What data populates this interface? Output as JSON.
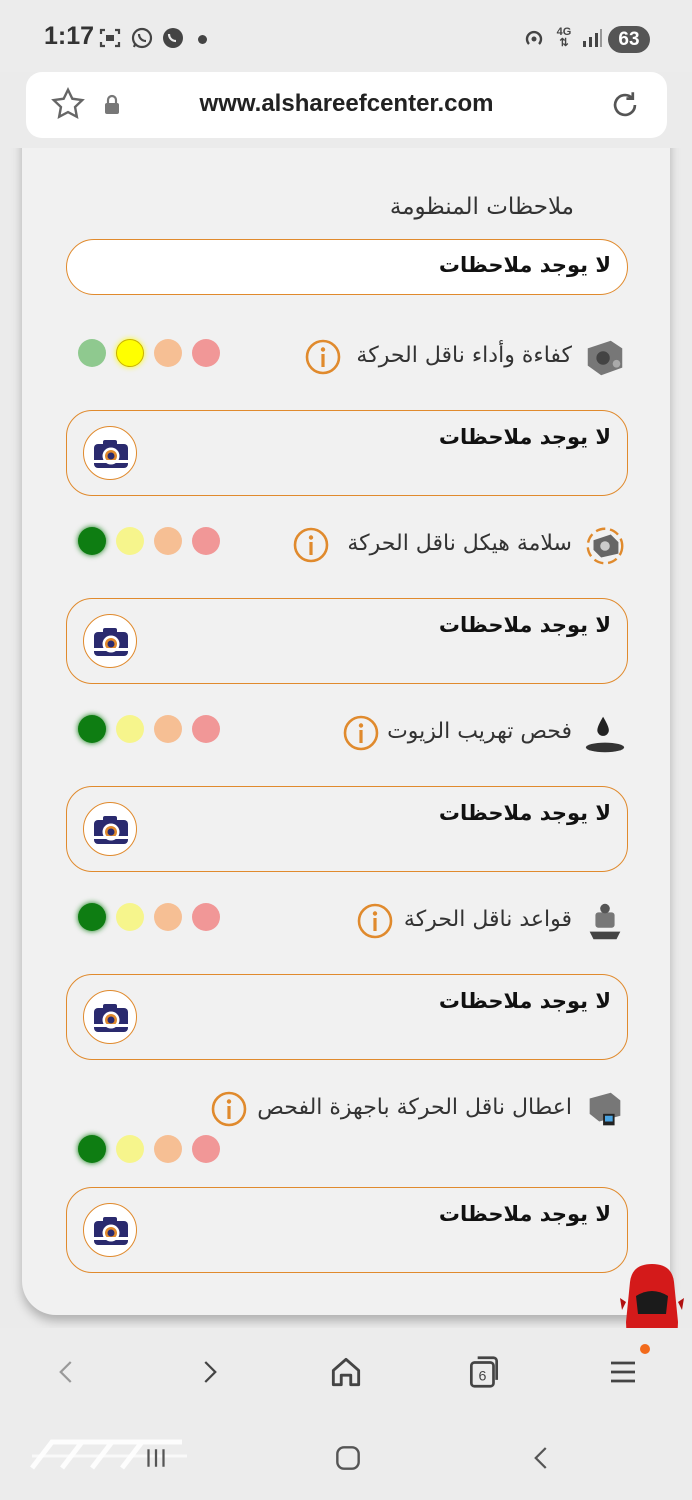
{
  "status_bar": {
    "time": "1:17",
    "battery": "63",
    "network": "4G"
  },
  "browser": {
    "url": "www.alshareefcenter.com",
    "tab_count": "6"
  },
  "system_notes": {
    "title": "ملاحظات المنظومة",
    "value": "لا يوجد ملاحظات"
  },
  "items": [
    {
      "label": "كفاءة وأداء ناقل الحركة",
      "note": "لا يوجد ملاحظات",
      "selected_light": "yellow"
    },
    {
      "label": "سلامة هيكل ناقل الحركة",
      "note": "لا يوجد ملاحظات",
      "selected_light": "green"
    },
    {
      "label": "فحص تهريب الزيوت",
      "note": "لا يوجد ملاحظات",
      "selected_light": "green"
    },
    {
      "label": "قواعد ناقل الحركة",
      "note": "لا يوجد ملاحظات",
      "selected_light": "green"
    },
    {
      "label": "اعطال ناقل الحركة باجهزة الفحص",
      "note": "لا يوجد ملاحظات",
      "selected_light": "green"
    }
  ],
  "colors": {
    "accent": "#e08a2d",
    "green_active": "#0e7d12",
    "green_dim": "#8fc98f",
    "yellow_active": "#ffff00",
    "yellow_dim": "#f6f58c",
    "orange_dim": "#f6bf94",
    "red_dim": "#f19797",
    "camera": "#2a2a6e"
  },
  "icons": {
    "info": "info-circle-icon",
    "camera": "camera-icon",
    "car": "red-car-icon"
  }
}
